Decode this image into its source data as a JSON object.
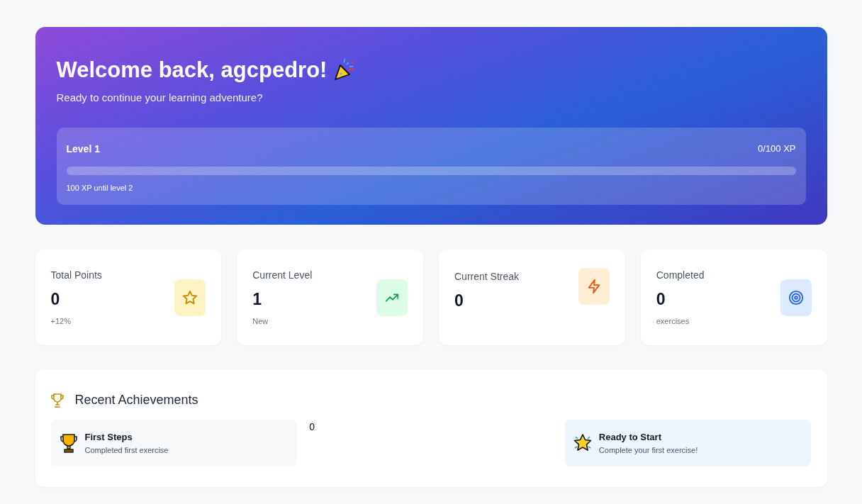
{
  "hero": {
    "title": "Welcome back, agcpedro!",
    "subtitle": "Ready to continue your learning adventure?",
    "progress": {
      "label": "Level 1",
      "reading": "0/100 XP",
      "level": 0,
      "note": "100 XP until level 2"
    }
  },
  "stats": [
    {
      "label": "Total Points",
      "value": "0",
      "sub": "+12%",
      "kind": "star"
    },
    {
      "label": "Current Level",
      "value": "1",
      "sub": "New",
      "kind": "trend"
    },
    {
      "label": "Current Streak",
      "value": "0",
      "kind": "bolt"
    },
    {
      "label": "Completed",
      "value": "0",
      "sub": "exercises",
      "kind": "target"
    }
  ],
  "achievements": {
    "title": "Recent Achievements",
    "items": [
      {
        "kind": "achievement",
        "title": "First Steps",
        "description": "Completed first exercise"
      },
      {
        "kind": "text",
        "text": "0"
      },
      {
        "kind": "highlight",
        "title": "Ready to Start",
        "description": "Complete your first exercise!"
      }
    ]
  }
}
